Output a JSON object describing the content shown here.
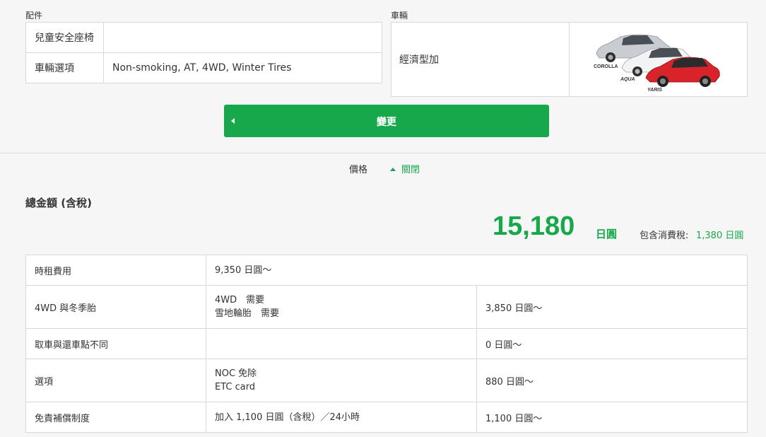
{
  "accessories": {
    "section_label": "配件",
    "rows": [
      {
        "label": "兒童安全座椅",
        "value": ""
      },
      {
        "label": "車輛選項",
        "value": "Non-smoking, AT, 4WD, Winter Tires"
      }
    ]
  },
  "vehicle": {
    "section_label": "車輛",
    "class_name": "經濟型加",
    "models": [
      "COROLLA",
      "AQUA",
      "YARIS"
    ]
  },
  "change_button": {
    "label": "變更"
  },
  "price_toggle": {
    "label": "價格",
    "close_label": "關閉"
  },
  "total": {
    "title": "總金額 (含稅)",
    "amount": "15,180",
    "unit": "日圓",
    "tax_label": "包含消費稅:",
    "tax_value": "1,380 日圓"
  },
  "fees": [
    {
      "label": "時租費用",
      "detail": [
        "9,350 日圓〜"
      ],
      "amount": ""
    },
    {
      "label": "4WD 與冬季胎",
      "detail": [
        "4WD　需要",
        "雪地輪胎　需要"
      ],
      "amount": "3,850 日圓〜"
    },
    {
      "label": "取車與還車點不同",
      "detail": [],
      "amount": "0 日圓〜"
    },
    {
      "label": "選項",
      "detail": [
        "NOC 免除",
        "ETC card"
      ],
      "amount": "880 日圓〜"
    },
    {
      "label": "免責補償制度",
      "detail": [
        "加入 1,100 日圓（含稅）／24小時"
      ],
      "amount": "1,100 日圓〜"
    }
  ],
  "colors": {
    "accent": "#16a84b",
    "car_red": "#d8232a",
    "car_silver": "#c9ccd0",
    "car_white": "#f2f3f4"
  }
}
